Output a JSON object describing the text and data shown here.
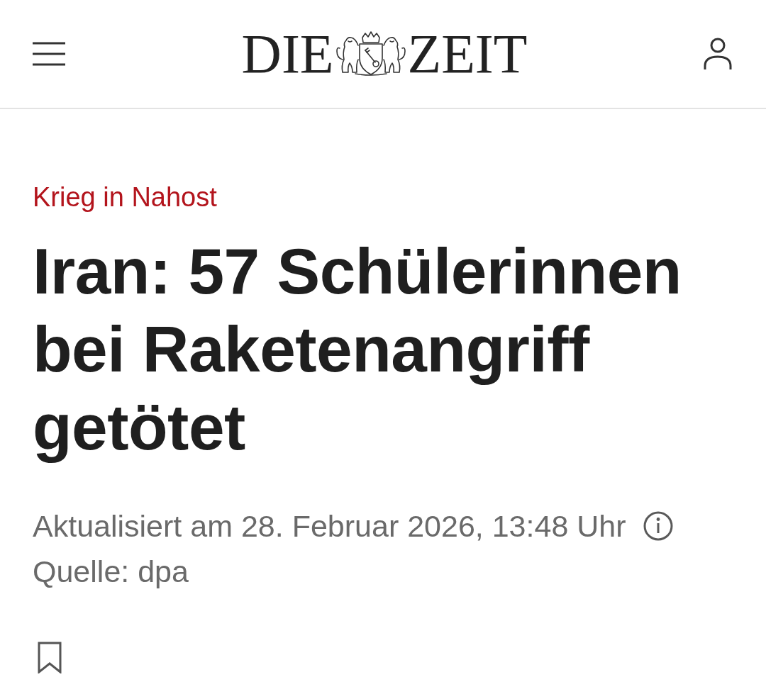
{
  "header": {
    "logo": {
      "left_word": "DIE",
      "right_word": "ZEIT"
    }
  },
  "article": {
    "kicker": "Krieg in Nahost",
    "headline": "Iran: 57 Schülerinnen bei Raketenangriff getötet",
    "updated": "Aktualisiert am 28. Februar 2026, 13:48 Uhr",
    "source": "Quelle: dpa"
  }
}
